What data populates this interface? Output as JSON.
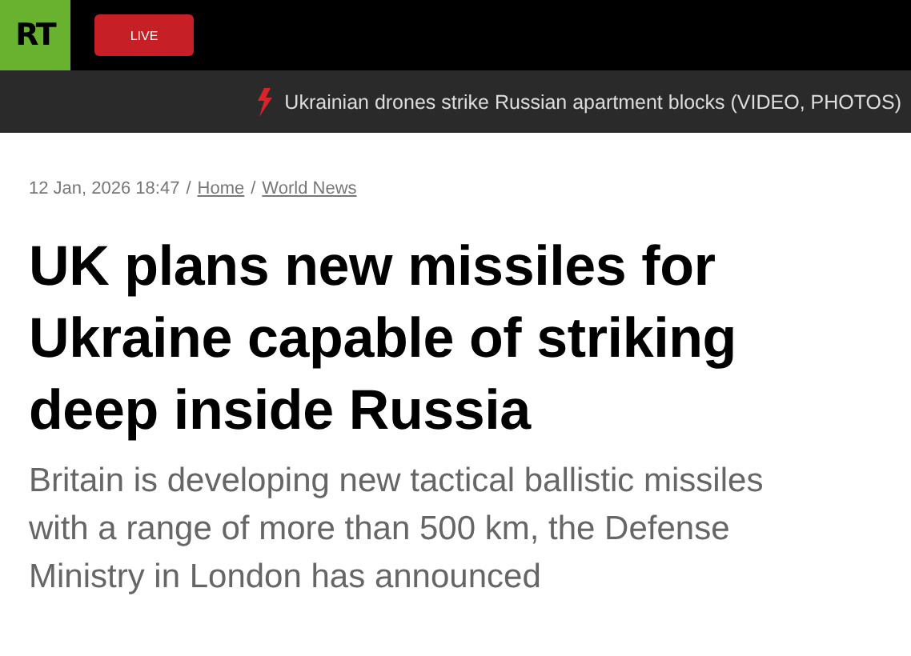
{
  "header": {
    "logo": "RT",
    "live_button": "LIVE"
  },
  "breaking_news": {
    "headline": "Ukrainian drones strike Russian apartment blocks (VIDEO, PHOTOS)"
  },
  "article": {
    "date": "12 Jan, 2026 18:47",
    "separator": "/",
    "breadcrumbs": [
      "Home",
      "World News"
    ],
    "title": "UK plans new missiles for Ukraine capable of striking deep inside Russia",
    "summary": "Britain is developing new tactical ballistic missiles with a range of more than 500 km, the Defense Ministry in London has announced"
  }
}
